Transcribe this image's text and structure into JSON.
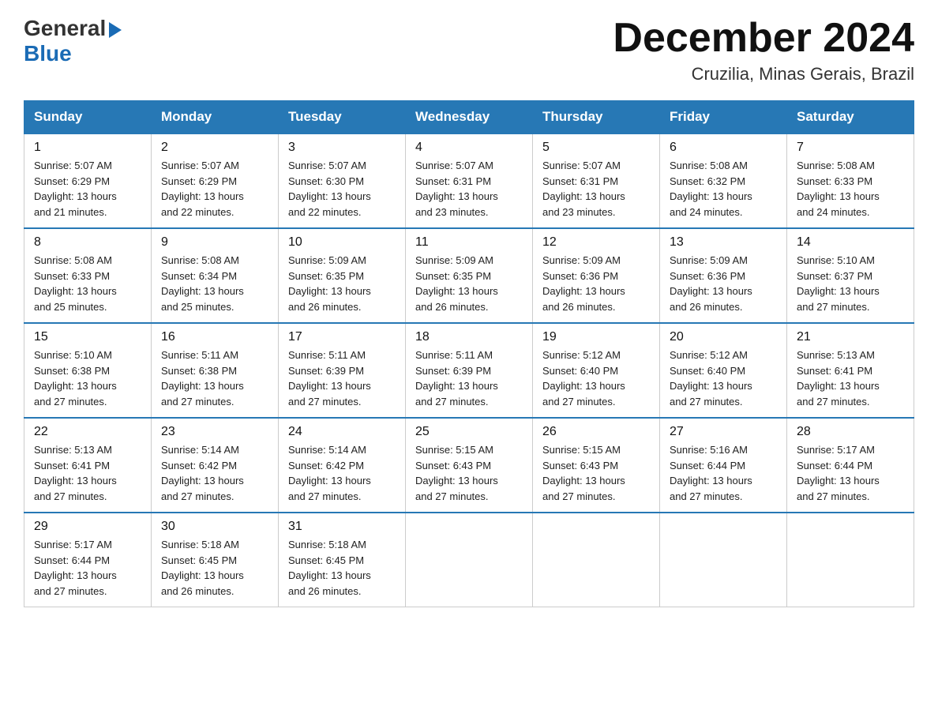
{
  "header": {
    "logo": {
      "general": "General",
      "arrow": "▶",
      "blue": "Blue"
    },
    "title": "December 2024",
    "location": "Cruzilia, Minas Gerais, Brazil"
  },
  "weekdays": [
    "Sunday",
    "Monday",
    "Tuesday",
    "Wednesday",
    "Thursday",
    "Friday",
    "Saturday"
  ],
  "weeks": [
    [
      {
        "day": "1",
        "sunrise": "5:07 AM",
        "sunset": "6:29 PM",
        "daylight": "13 hours and 21 minutes."
      },
      {
        "day": "2",
        "sunrise": "5:07 AM",
        "sunset": "6:29 PM",
        "daylight": "13 hours and 22 minutes."
      },
      {
        "day": "3",
        "sunrise": "5:07 AM",
        "sunset": "6:30 PM",
        "daylight": "13 hours and 22 minutes."
      },
      {
        "day": "4",
        "sunrise": "5:07 AM",
        "sunset": "6:31 PM",
        "daylight": "13 hours and 23 minutes."
      },
      {
        "day": "5",
        "sunrise": "5:07 AM",
        "sunset": "6:31 PM",
        "daylight": "13 hours and 23 minutes."
      },
      {
        "day": "6",
        "sunrise": "5:08 AM",
        "sunset": "6:32 PM",
        "daylight": "13 hours and 24 minutes."
      },
      {
        "day": "7",
        "sunrise": "5:08 AM",
        "sunset": "6:33 PM",
        "daylight": "13 hours and 24 minutes."
      }
    ],
    [
      {
        "day": "8",
        "sunrise": "5:08 AM",
        "sunset": "6:33 PM",
        "daylight": "13 hours and 25 minutes."
      },
      {
        "day": "9",
        "sunrise": "5:08 AM",
        "sunset": "6:34 PM",
        "daylight": "13 hours and 25 minutes."
      },
      {
        "day": "10",
        "sunrise": "5:09 AM",
        "sunset": "6:35 PM",
        "daylight": "13 hours and 26 minutes."
      },
      {
        "day": "11",
        "sunrise": "5:09 AM",
        "sunset": "6:35 PM",
        "daylight": "13 hours and 26 minutes."
      },
      {
        "day": "12",
        "sunrise": "5:09 AM",
        "sunset": "6:36 PM",
        "daylight": "13 hours and 26 minutes."
      },
      {
        "day": "13",
        "sunrise": "5:09 AM",
        "sunset": "6:36 PM",
        "daylight": "13 hours and 26 minutes."
      },
      {
        "day": "14",
        "sunrise": "5:10 AM",
        "sunset": "6:37 PM",
        "daylight": "13 hours and 27 minutes."
      }
    ],
    [
      {
        "day": "15",
        "sunrise": "5:10 AM",
        "sunset": "6:38 PM",
        "daylight": "13 hours and 27 minutes."
      },
      {
        "day": "16",
        "sunrise": "5:11 AM",
        "sunset": "6:38 PM",
        "daylight": "13 hours and 27 minutes."
      },
      {
        "day": "17",
        "sunrise": "5:11 AM",
        "sunset": "6:39 PM",
        "daylight": "13 hours and 27 minutes."
      },
      {
        "day": "18",
        "sunrise": "5:11 AM",
        "sunset": "6:39 PM",
        "daylight": "13 hours and 27 minutes."
      },
      {
        "day": "19",
        "sunrise": "5:12 AM",
        "sunset": "6:40 PM",
        "daylight": "13 hours and 27 minutes."
      },
      {
        "day": "20",
        "sunrise": "5:12 AM",
        "sunset": "6:40 PM",
        "daylight": "13 hours and 27 minutes."
      },
      {
        "day": "21",
        "sunrise": "5:13 AM",
        "sunset": "6:41 PM",
        "daylight": "13 hours and 27 minutes."
      }
    ],
    [
      {
        "day": "22",
        "sunrise": "5:13 AM",
        "sunset": "6:41 PM",
        "daylight": "13 hours and 27 minutes."
      },
      {
        "day": "23",
        "sunrise": "5:14 AM",
        "sunset": "6:42 PM",
        "daylight": "13 hours and 27 minutes."
      },
      {
        "day": "24",
        "sunrise": "5:14 AM",
        "sunset": "6:42 PM",
        "daylight": "13 hours and 27 minutes."
      },
      {
        "day": "25",
        "sunrise": "5:15 AM",
        "sunset": "6:43 PM",
        "daylight": "13 hours and 27 minutes."
      },
      {
        "day": "26",
        "sunrise": "5:15 AM",
        "sunset": "6:43 PM",
        "daylight": "13 hours and 27 minutes."
      },
      {
        "day": "27",
        "sunrise": "5:16 AM",
        "sunset": "6:44 PM",
        "daylight": "13 hours and 27 minutes."
      },
      {
        "day": "28",
        "sunrise": "5:17 AM",
        "sunset": "6:44 PM",
        "daylight": "13 hours and 27 minutes."
      }
    ],
    [
      {
        "day": "29",
        "sunrise": "5:17 AM",
        "sunset": "6:44 PM",
        "daylight": "13 hours and 27 minutes."
      },
      {
        "day": "30",
        "sunrise": "5:18 AM",
        "sunset": "6:45 PM",
        "daylight": "13 hours and 26 minutes."
      },
      {
        "day": "31",
        "sunrise": "5:18 AM",
        "sunset": "6:45 PM",
        "daylight": "13 hours and 26 minutes."
      },
      null,
      null,
      null,
      null
    ]
  ],
  "labels": {
    "sunrise": "Sunrise:",
    "sunset": "Sunset:",
    "daylight": "Daylight:"
  }
}
